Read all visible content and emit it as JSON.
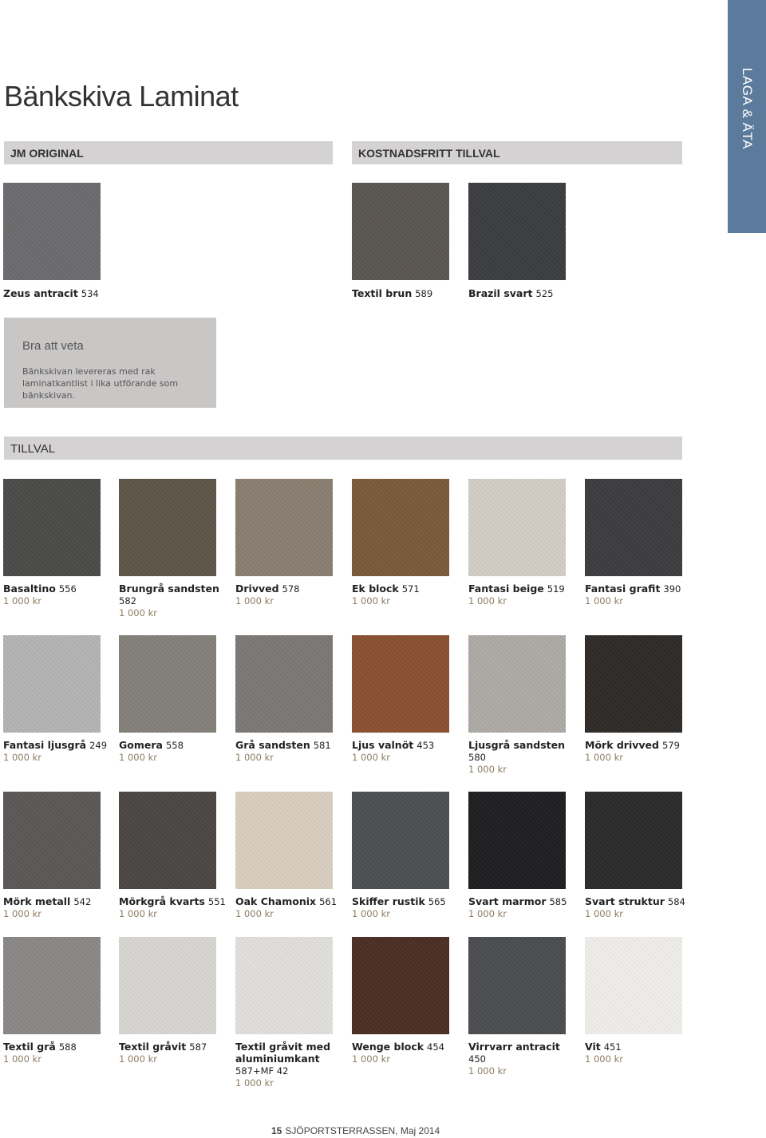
{
  "side_tab": "LAGA & ÄTA",
  "title": "Bänkskiva Laminat",
  "sections": {
    "original": "JM ORIGINAL",
    "free": "KOSTNADSFRITT TILLVAL",
    "tillval": "TILLVAL"
  },
  "info": {
    "heading": "Bra att veta",
    "text": "Bänkskivan levereras med rak laminatkantlist i lika utförande som bänkskivan."
  },
  "original_items": [
    {
      "name": "Zeus antracit",
      "code": "534",
      "color": "#6b6b6d"
    }
  ],
  "free_items": [
    {
      "name": "Textil brun",
      "code": "589",
      "color": "#5a5550"
    },
    {
      "name": "Brazil svart",
      "code": "525",
      "color": "#3a3c40"
    }
  ],
  "tillval_items": [
    {
      "name": "Basaltino",
      "code": "556",
      "price": "1 000 kr",
      "color": "#4a4a48"
    },
    {
      "name": "Brungrå sandsten",
      "code": "582",
      "price": "1 000 kr",
      "color": "#5e5448"
    },
    {
      "name": "Drivved",
      "code": "578",
      "price": "1 000 kr",
      "color": "#8a7e70"
    },
    {
      "name": "Ek block",
      "code": "571",
      "price": "1 000 kr",
      "color": "#7a5a38"
    },
    {
      "name": "Fantasi beige",
      "code": "519",
      "price": "1 000 kr",
      "color": "#d2cec6"
    },
    {
      "name": "Fantasi grafit",
      "code": "390",
      "price": "1 000 kr",
      "color": "#3c3c3e"
    },
    {
      "name": "Fantasi ljusgrå",
      "code": "249",
      "price": "1 000 kr",
      "color": "#b4b4b4"
    },
    {
      "name": "Gomera",
      "code": "558",
      "price": "1 000 kr",
      "color": "#838079"
    },
    {
      "name": "Grå sandsten",
      "code": "581",
      "price": "1 000 kr",
      "color": "#7c7876"
    },
    {
      "name": "Ljus valnöt",
      "code": "453",
      "price": "1 000 kr",
      "color": "#8a5030"
    },
    {
      "name": "Ljusgrå sandsten",
      "code": "580",
      "price": "1 000 kr",
      "color": "#aeaaa6"
    },
    {
      "name": "Mörk drivved",
      "code": "579",
      "price": "1 000 kr",
      "color": "#2e2a28"
    },
    {
      "name": "Mörk metall",
      "code": "542",
      "price": "1 000 kr",
      "color": "#5a5856"
    },
    {
      "name": "Mörkgrå kvarts",
      "code": "551",
      "price": "1 000 kr",
      "color": "#4a4644"
    },
    {
      "name": "Oak Chamonix",
      "code": "561",
      "price": "1 000 kr",
      "color": "#d8cfc0"
    },
    {
      "name": "Skiffer rustik",
      "code": "565",
      "price": "1 000 kr",
      "color": "#4c4e50"
    },
    {
      "name": "Svart marmor",
      "code": "585",
      "price": "1 000 kr",
      "color": "#1e1e20"
    },
    {
      "name": "Svart struktur",
      "code": "584",
      "price": "1 000 kr",
      "color": "#2a2a2a"
    },
    {
      "name": "Textil grå",
      "code": "588",
      "price": "1 000 kr",
      "color": "#8a8886"
    },
    {
      "name": "Textil gråvit",
      "code": "587",
      "price": "1 000 kr",
      "color": "#d8d6d2"
    },
    {
      "name": "Textil gråvit med aluminiumkant",
      "code": "587+MF 42",
      "price": "1 000 kr",
      "color": "#e2e0dc"
    },
    {
      "name": "Wenge block",
      "code": "454",
      "price": "1 000 kr",
      "color": "#4a2e22"
    },
    {
      "name": "Virrvarr antracit",
      "code": "450",
      "price": "1 000 kr",
      "color": "#4a4c50"
    },
    {
      "name": "Vit",
      "code": "451",
      "price": "1 000 kr",
      "color": "#f0eeea"
    }
  ],
  "footer": {
    "page": "15",
    "project": "SJÖPORTSTERRASSEN,",
    "date": "Maj 2014"
  }
}
